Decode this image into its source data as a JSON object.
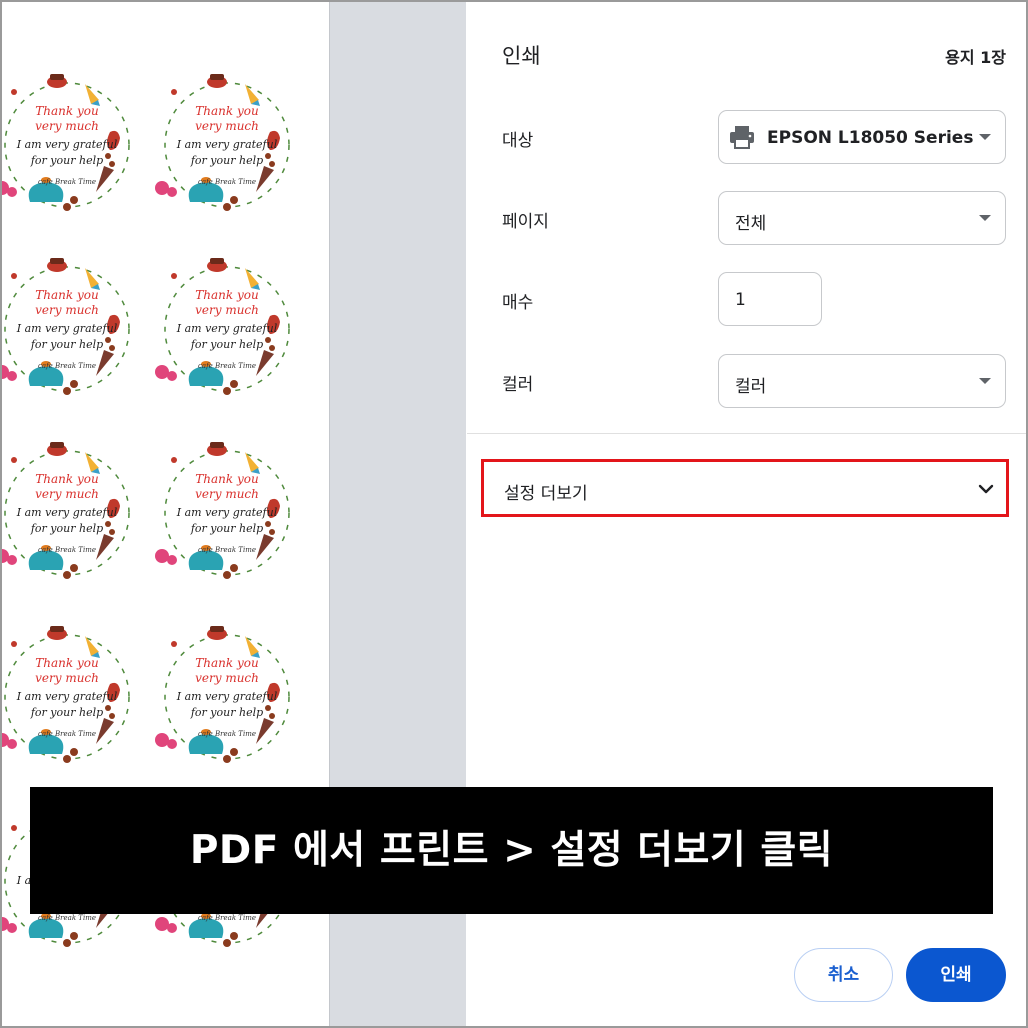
{
  "preview": {
    "sticker": {
      "line1": "Thank you",
      "line2": "very much",
      "line3": "I am very grateful",
      "line4": "for your help",
      "line5": "cafe Break Time"
    }
  },
  "dialog": {
    "title": "인쇄",
    "sheet_count": "용지 1장",
    "destination": {
      "label": "대상",
      "value": "EPSON L18050 Series",
      "icon": "printer-icon"
    },
    "pages": {
      "label": "페이지",
      "value": "전체"
    },
    "copies": {
      "label": "매수",
      "value": "1"
    },
    "color": {
      "label": "컬러",
      "value": "컬러"
    },
    "more_settings": {
      "label": "설정 더보기",
      "icon": "chevron-down-icon",
      "highlight_color": "#e3151a"
    },
    "cancel_label": "취소",
    "print_label": "인쇄"
  },
  "caption": "PDF 에서 프린트 > 설정 더보기 클릭",
  "colors": {
    "accent": "#0b57d0",
    "highlight": "#e3151a",
    "sticker_red": "#d9302c"
  }
}
